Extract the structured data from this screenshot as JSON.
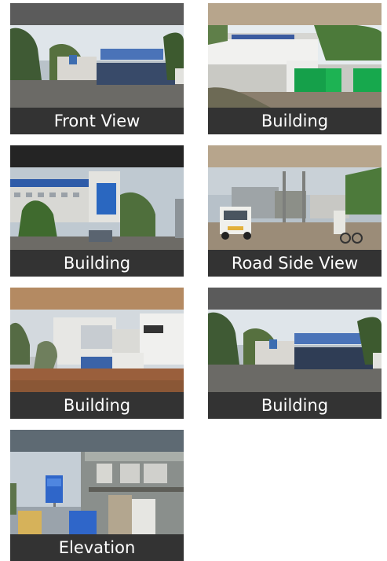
{
  "gallery": {
    "tiles": [
      {
        "caption": "Front View",
        "topbar_color": "#5b5b5b"
      },
      {
        "caption": "Building",
        "topbar_color": "#b7a58c"
      },
      {
        "caption": "Building",
        "topbar_color": "#242424"
      },
      {
        "caption": "Road Side View",
        "topbar_color": "#b7a58c"
      },
      {
        "caption": "Building",
        "topbar_color": "#b48a62"
      },
      {
        "caption": "Building",
        "topbar_color": "#5b5b5b"
      },
      {
        "caption": "Elevation",
        "topbar_color": "#5e6a73"
      }
    ]
  }
}
